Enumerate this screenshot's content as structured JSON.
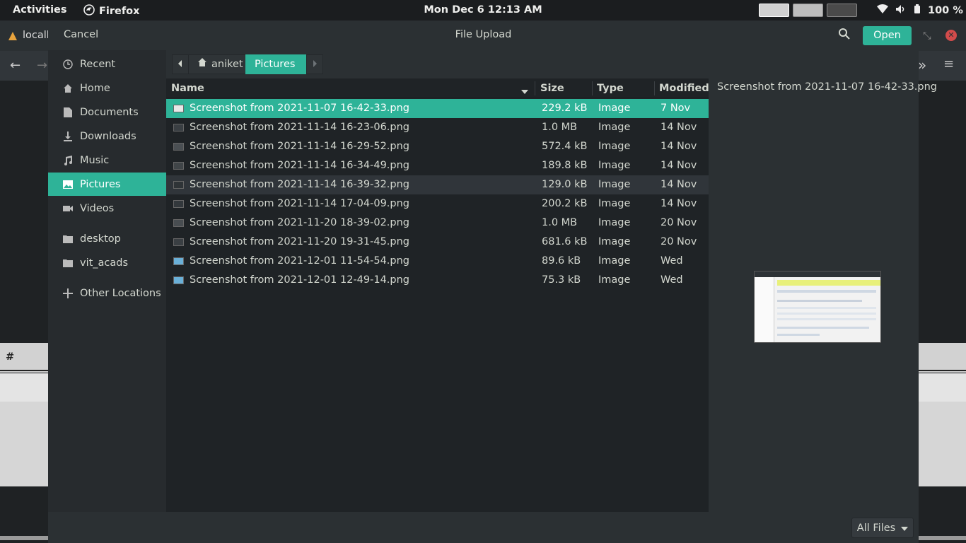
{
  "topbar": {
    "activities": "Activities",
    "app_name": "Firefox",
    "clock": "Mon Dec 6  12:13 AM",
    "battery": "100 %"
  },
  "browser": {
    "tab_partial": "localh",
    "table_header_partial": "#"
  },
  "dialog": {
    "title": "File Upload",
    "cancel_label": "Cancel",
    "open_label": "Open",
    "filter_label": "All Files",
    "accent_color": "#2eb398"
  },
  "sidebar": {
    "items": [
      {
        "label": "Recent",
        "icon": "clock-icon"
      },
      {
        "label": "Home",
        "icon": "home-icon"
      },
      {
        "label": "Documents",
        "icon": "document-icon"
      },
      {
        "label": "Downloads",
        "icon": "download-icon"
      },
      {
        "label": "Music",
        "icon": "music-icon"
      },
      {
        "label": "Pictures",
        "icon": "picture-icon",
        "active": true
      },
      {
        "label": "Videos",
        "icon": "video-icon"
      },
      {
        "label": "desktop",
        "icon": "folder-icon"
      },
      {
        "label": "vit_acads",
        "icon": "folder-icon"
      },
      {
        "label": "Other Locations",
        "icon": "plus-icon"
      }
    ]
  },
  "pathbar": {
    "crumbs": [
      "aniket",
      "Pictures"
    ]
  },
  "columns": {
    "name": "Name",
    "size": "Size",
    "type": "Type",
    "modified": "Modified"
  },
  "files": [
    {
      "name": "Screenshot from 2021-11-07 16-42-33.png",
      "size": "229.2 kB",
      "type": "Image",
      "modified": "7 Nov"
    },
    {
      "name": "Screenshot from 2021-11-14 16-23-06.png",
      "size": "1.0 MB",
      "type": "Image",
      "modified": "14 Nov"
    },
    {
      "name": "Screenshot from 2021-11-14 16-29-52.png",
      "size": "572.4 kB",
      "type": "Image",
      "modified": "14 Nov"
    },
    {
      "name": "Screenshot from 2021-11-14 16-34-49.png",
      "size": "189.8 kB",
      "type": "Image",
      "modified": "14 Nov"
    },
    {
      "name": "Screenshot from 2021-11-14 16-39-32.png",
      "size": "129.0 kB",
      "type": "Image",
      "modified": "14 Nov"
    },
    {
      "name": "Screenshot from 2021-11-14 17-04-09.png",
      "size": "200.2 kB",
      "type": "Image",
      "modified": "14 Nov"
    },
    {
      "name": "Screenshot from 2021-11-20 18-39-02.png",
      "size": "1.0 MB",
      "type": "Image",
      "modified": "20 Nov"
    },
    {
      "name": "Screenshot from 2021-11-20 19-31-45.png",
      "size": "681.6 kB",
      "type": "Image",
      "modified": "20 Nov"
    },
    {
      "name": "Screenshot from 2021-12-01 11-54-54.png",
      "size": "89.6 kB",
      "type": "Image",
      "modified": "Wed"
    },
    {
      "name": "Screenshot from 2021-12-01 12-49-14.png",
      "size": "75.3 kB",
      "type": "Image",
      "modified": "Wed"
    }
  ],
  "preview": {
    "filename": "Screenshot from 2021-11-07 16-42-33.png"
  }
}
